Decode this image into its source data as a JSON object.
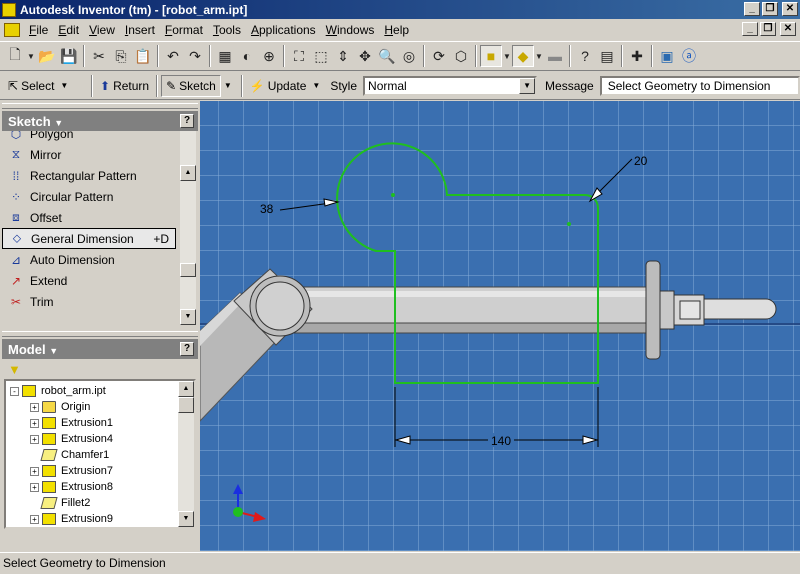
{
  "window": {
    "title": "Autodesk Inventor (tm) - [robot_arm.ipt]"
  },
  "menu": [
    {
      "label": "File"
    },
    {
      "label": "Edit"
    },
    {
      "label": "View"
    },
    {
      "label": "Insert"
    },
    {
      "label": "Format"
    },
    {
      "label": "Tools"
    },
    {
      "label": "Applications"
    },
    {
      "label": "Windows"
    },
    {
      "label": "Help"
    }
  ],
  "toolbar2": {
    "select_label": "Select",
    "return_label": "Return",
    "sketch_label": "Sketch",
    "update_label": "Update",
    "style_label": "Style",
    "style_value": "Normal",
    "message_label": "Message",
    "message_value": "Select Geometry to Dimension"
  },
  "sketch_panel": {
    "title": "Sketch",
    "items": [
      {
        "label": "Polygon",
        "icon": "polygon-icon",
        "shortcut": ""
      },
      {
        "label": "Mirror",
        "icon": "mirror-icon",
        "shortcut": ""
      },
      {
        "label": "Rectangular Pattern",
        "icon": "rectangular-pattern-icon",
        "shortcut": ""
      },
      {
        "label": "Circular Pattern",
        "icon": "circular-pattern-icon",
        "shortcut": ""
      },
      {
        "label": "Offset",
        "icon": "offset-icon",
        "shortcut": ""
      },
      {
        "label": "General Dimension",
        "icon": "general-dimension-icon",
        "shortcut": "+D",
        "selected": true
      },
      {
        "label": "Auto Dimension",
        "icon": "auto-dimension-icon",
        "shortcut": ""
      },
      {
        "label": "Extend",
        "icon": "extend-icon",
        "shortcut": ""
      },
      {
        "label": "Trim",
        "icon": "trim-icon",
        "shortcut": ""
      }
    ]
  },
  "model_panel": {
    "title": "Model",
    "tree": [
      {
        "label": "robot_arm.ipt",
        "level": 0,
        "expander": "-",
        "icon": "part"
      },
      {
        "label": "Origin",
        "level": 1,
        "expander": "+",
        "icon": "folder"
      },
      {
        "label": "Extrusion1",
        "level": 1,
        "expander": "+",
        "icon": "feature"
      },
      {
        "label": "Extrusion4",
        "level": 1,
        "expander": "+",
        "icon": "feature"
      },
      {
        "label": "Chamfer1",
        "level": 1,
        "expander": "",
        "icon": "sketch"
      },
      {
        "label": "Extrusion7",
        "level": 1,
        "expander": "+",
        "icon": "feature"
      },
      {
        "label": "Extrusion8",
        "level": 1,
        "expander": "+",
        "icon": "feature"
      },
      {
        "label": "Fillet2",
        "level": 1,
        "expander": "",
        "icon": "sketch"
      },
      {
        "label": "Extrusion9",
        "level": 1,
        "expander": "+",
        "icon": "feature"
      }
    ]
  },
  "sketch": {
    "dimensions": [
      {
        "name": "radius-dimension-38",
        "value": "38"
      },
      {
        "name": "radius-dimension-20",
        "value": "20"
      },
      {
        "name": "linear-dimension-140",
        "value": "140"
      }
    ],
    "colors": {
      "background": "#3a6fb0",
      "grid": "#7fa6d6",
      "profile": "#1fbf1f",
      "part": "#c9c9c9"
    }
  },
  "status": {
    "text": "Select Geometry to Dimension"
  }
}
